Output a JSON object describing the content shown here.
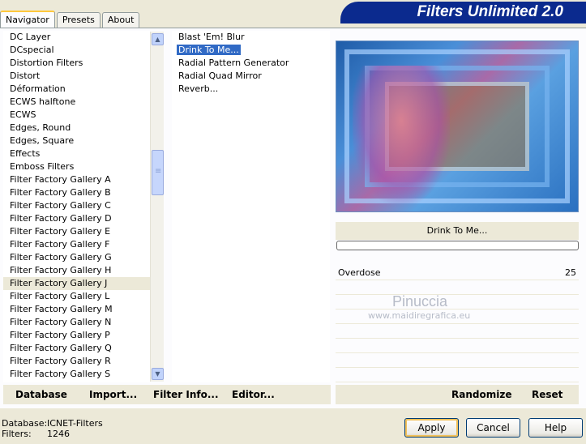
{
  "tabs": [
    "Navigator",
    "Presets",
    "About"
  ],
  "title": "Filters Unlimited 2.0",
  "categories": [
    "DC Layer",
    "DCspecial",
    "Distortion Filters",
    "Distort",
    "Déformation",
    "ECWS halftone",
    "ECWS",
    "Edges, Round",
    "Edges, Square",
    "Effects",
    "Emboss Filters",
    "Filter Factory Gallery A",
    "Filter Factory Gallery B",
    "Filter Factory Gallery C",
    "Filter Factory Gallery D",
    "Filter Factory Gallery E",
    "Filter Factory Gallery F",
    "Filter Factory Gallery G",
    "Filter Factory Gallery H",
    "Filter Factory Gallery J",
    "Filter Factory Gallery L",
    "Filter Factory Gallery M",
    "Filter Factory Gallery N",
    "Filter Factory Gallery P",
    "Filter Factory Gallery Q",
    "Filter Factory Gallery R",
    "Filter Factory Gallery S"
  ],
  "filters": [
    "Blast 'Em! Blur",
    "Drink To Me...",
    "Radial Pattern Generator",
    "Radial Quad Mirror",
    "Reverb..."
  ],
  "selected_filter_name": "Drink To Me...",
  "param": {
    "name": "Overdose",
    "value": "25"
  },
  "watermark": {
    "name": "Pinuccia",
    "url": "www.maidiregrafica.eu"
  },
  "bottom_links": {
    "database": "Database",
    "import": "Import...",
    "filter_info": "Filter Info...",
    "editor": "Editor...",
    "randomize": "Randomize",
    "reset": "Reset"
  },
  "status": {
    "database_label": "Database:",
    "database_value": "ICNET-Filters",
    "filters_label": "Filters:",
    "filters_value": "1246"
  },
  "buttons": {
    "apply": "Apply",
    "cancel": "Cancel",
    "help": "Help"
  }
}
